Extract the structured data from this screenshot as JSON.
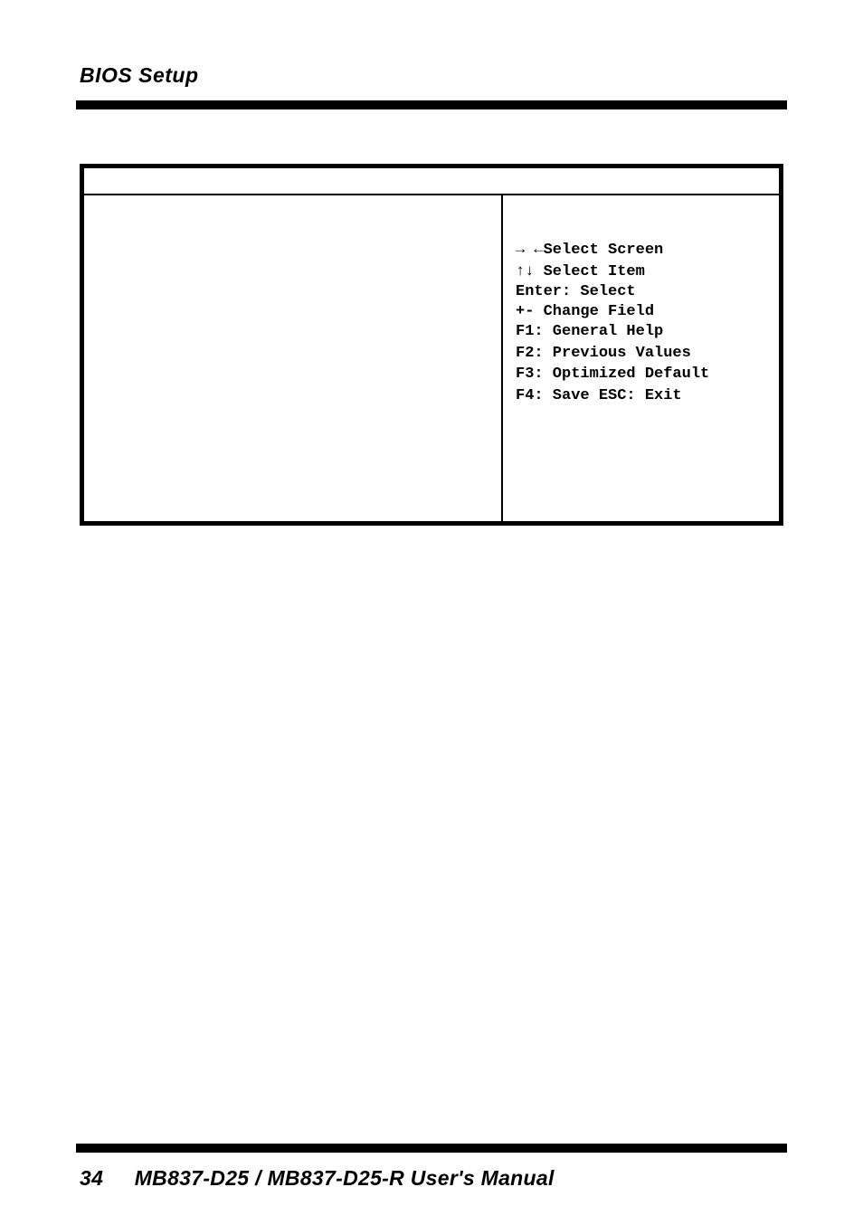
{
  "header": {
    "title": "BIOS Setup"
  },
  "bios": {
    "help": {
      "select_screen": "→ ←Select Screen",
      "select_item": "↑↓ Select Item",
      "enter": "Enter: Select",
      "change_field": "+-  Change Field",
      "general_help": "F1: General Help",
      "previous_values": "F2: Previous Values",
      "optimized_default": "F3: Optimized Default",
      "save_exit": "F4: Save  ESC: Exit"
    }
  },
  "footer": {
    "page_number": "34",
    "manual_title": "MB837-D25 / MB837-D25-R  User's Manual"
  }
}
